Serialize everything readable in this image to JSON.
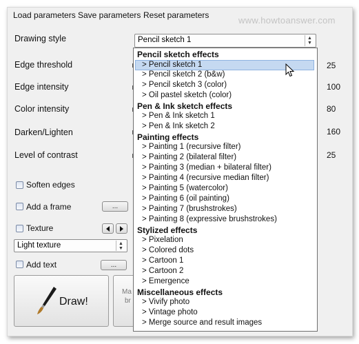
{
  "menu": {
    "load": "Load parameters",
    "save": "Save parameters",
    "reset": "Reset parameters"
  },
  "watermark": "www.howtoanswer.com",
  "drawing_style": {
    "label": "Drawing style",
    "selected": "Pencil sketch 1"
  },
  "params": [
    {
      "label": "Edge threshold",
      "value": "25"
    },
    {
      "label": "Edge intensity",
      "value": "100"
    },
    {
      "label": "Color intensity",
      "value": "80"
    },
    {
      "label": "Darken/Lighten",
      "value": "160"
    },
    {
      "label": "Level of contrast",
      "value": "25"
    }
  ],
  "options": {
    "soften_edges": "Soften edges",
    "add_frame": "Add a frame",
    "texture": "Texture",
    "texture_select": "Light texture",
    "add_text": "Add text",
    "more_button": "...",
    "prev_icon": "triangle-left-icon",
    "next_icon": "triangle-right-icon"
  },
  "draw_button": {
    "label": "Draw!",
    "icon": "paintbrush-icon"
  },
  "partial_button": {
    "line1": "Ma",
    "line2": "br"
  },
  "dropdown": {
    "groups": [
      {
        "title": "Pencil sketch effects",
        "items": [
          "> Pencil sketch 1",
          "> Pencil sketch 2 (b&w)",
          "> Pencil sketch 3 (color)",
          "> Oil pastel sketch (color)"
        ]
      },
      {
        "title": "Pen & Ink sketch effects",
        "items": [
          "> Pen & Ink sketch 1",
          "> Pen & Ink sketch 2"
        ]
      },
      {
        "title": "Painting effects",
        "items": [
          "> Painting 1 (recursive filter)",
          "> Painting 2 (bilateral filter)",
          "> Painting 3 (median + bilateral filter)",
          "> Painting 4 (recursive median filter)",
          "> Painting 5 (watercolor)",
          "> Painting 6 (oil painting)",
          "> Painting 7 (brushstrokes)",
          "> Painting 8 (expressive brushstrokes)"
        ]
      },
      {
        "title": "Stylized effects",
        "items": [
          "> Pixelation",
          "> Colored dots",
          "> Cartoon 1",
          "> Cartoon 2",
          "> Emergence"
        ]
      },
      {
        "title": "Miscellaneous effects",
        "items": [
          "> Vivify photo",
          "> Vintage photo",
          "> Merge source and result images"
        ]
      }
    ]
  }
}
